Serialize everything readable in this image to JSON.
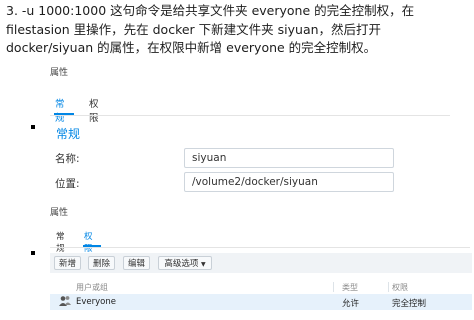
{
  "step_text": "3. -u 1000:1000 这句命令是给共享文件夹 everyone 的完全控制权，在 filestasion 里操作，先在 docker 下新建文件夹 siyuan，然后打开 docker/siyuan 的属性，在权限中新增 everyone 的完全控制权。",
  "dialog1": {
    "title": "属性",
    "tabs": [
      "常规",
      "权限"
    ],
    "section_title": "常规",
    "name_label": "名称:",
    "name_value": "siyuan",
    "location_label": "位置:",
    "location_value": "/volume2/docker/siyuan"
  },
  "dialog2": {
    "title": "属性",
    "tabs": [
      "常规",
      "权限"
    ],
    "toolbar": [
      "新增",
      "删除",
      "编辑",
      "高级选项"
    ],
    "columns": [
      "用户或组",
      "类型",
      "权限"
    ],
    "rows": [
      {
        "user": "Everyone",
        "type": "允许",
        "permission": "完全控制"
      }
    ]
  },
  "colors": {
    "accent": "#0086e5",
    "selected_row": "#e6f1fb",
    "toolbar_bg": "#f0f3f6"
  }
}
